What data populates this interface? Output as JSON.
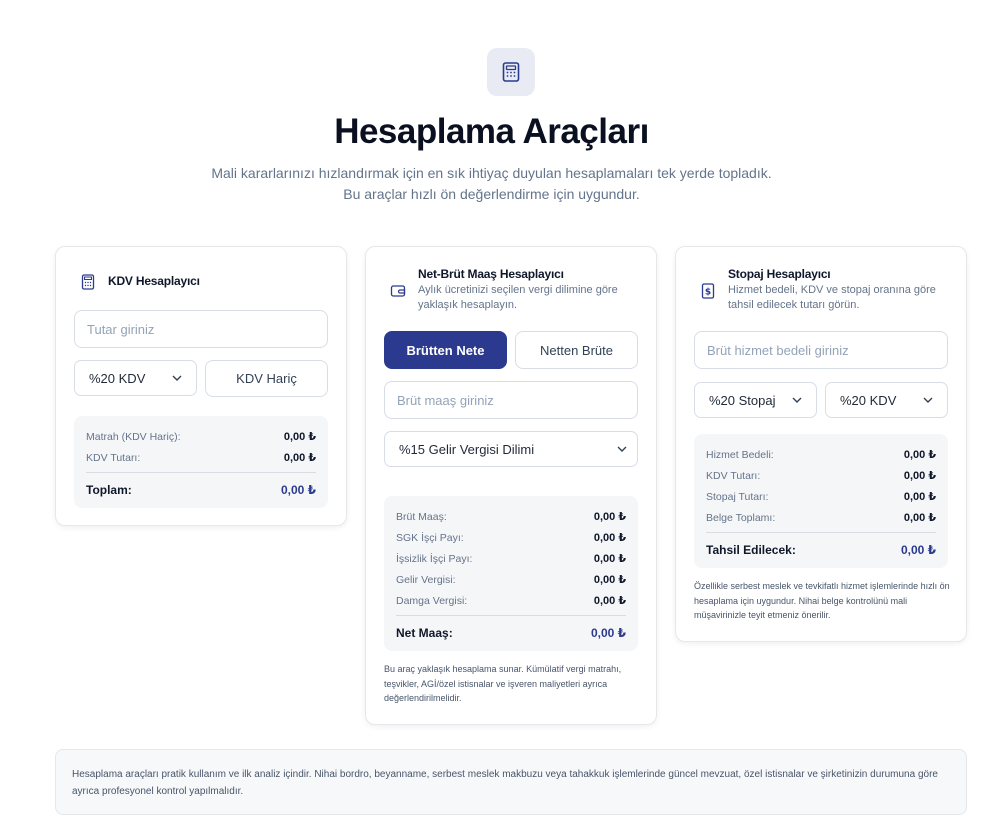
{
  "hero": {
    "icon": "calculator-icon",
    "title": "Hesaplama Araçları",
    "subtitle_line1": "Mali kararlarınızı hızlandırmak için en sık ihtiyaç duyulan hesaplamaları tek yerde topladık.",
    "subtitle_line2": "Bu araçlar hızlı ön değerlendirme için uygundur."
  },
  "kdv": {
    "title": "KDV Hesaplayıcı",
    "amount_placeholder": "Tutar giriniz",
    "rate_select": "%20 KDV",
    "mode_button": "KDV Hariç",
    "rows": [
      {
        "label": "Matrah (KDV Hariç):",
        "value": "0,00 ₺"
      },
      {
        "label": "KDV Tutarı:",
        "value": "0,00 ₺"
      }
    ],
    "total_label": "Toplam:",
    "total_value": "0,00 ₺"
  },
  "salary": {
    "title": "Net-Brüt Maaş Hesaplayıcı",
    "desc": "Aylık ücretinizi seçilen vergi dilimine göre yaklaşık hesaplayın.",
    "tab_gross_to_net": "Brütten Nete",
    "tab_net_to_gross": "Netten Brüte",
    "amount_placeholder": "Brüt maaş giriniz",
    "bracket_select": "%15 Gelir Vergisi Dilimi",
    "rows": [
      {
        "label": "Brüt Maaş:",
        "value": "0,00 ₺"
      },
      {
        "label": "SGK İşçi Payı:",
        "value": "0,00 ₺"
      },
      {
        "label": "İşsizlik İşçi Payı:",
        "value": "0,00 ₺"
      },
      {
        "label": "Gelir Vergisi:",
        "value": "0,00 ₺"
      },
      {
        "label": "Damga Vergisi:",
        "value": "0,00 ₺"
      }
    ],
    "total_label": "Net Maaş:",
    "total_value": "0,00 ₺",
    "note": "Bu araç yaklaşık hesaplama sunar. Kümülatif vergi matrahı, teşvikler, AGİ/özel istisnalar ve işveren maliyetleri ayrıca değerlendirilmelidir."
  },
  "stopaj": {
    "title": "Stopaj Hesaplayıcı",
    "desc": "Hizmet bedeli, KDV ve stopaj oranına göre tahsil edilecek tutarı görün.",
    "amount_placeholder": "Brüt hizmet bedeli giriniz",
    "stopaj_select": "%20 Stopaj",
    "kdv_select": "%20 KDV",
    "rows": [
      {
        "label": "Hizmet Bedeli:",
        "value": "0,00 ₺"
      },
      {
        "label": "KDV Tutarı:",
        "value": "0,00 ₺"
      },
      {
        "label": "Stopaj Tutarı:",
        "value": "0,00 ₺"
      },
      {
        "label": "Belge Toplamı:",
        "value": "0,00 ₺"
      }
    ],
    "total_label": "Tahsil Edilecek:",
    "total_value": "0,00 ₺",
    "note": "Özellikle serbest meslek ve tevkifatlı hizmet işlemlerinde hızlı ön hesaplama için uygundur. Nihai belge kontrolünü mali müşavirinizle teyit etmeniz önerilir."
  },
  "disclaimer": "Hesaplama araçları pratik kullanım ve ilk analiz içindir. Nihai bordro, beyanname, serbest meslek makbuzu veya tahakkuk işlemlerinde güncel mevzuat, özel istisnalar ve şirketinizin durumuna göre ayrıca profesyonel kontrol yapılmalıdır.",
  "colors": {
    "primary": "#2b3a8f",
    "muted": "#64748b",
    "border": "#d8dde5"
  }
}
